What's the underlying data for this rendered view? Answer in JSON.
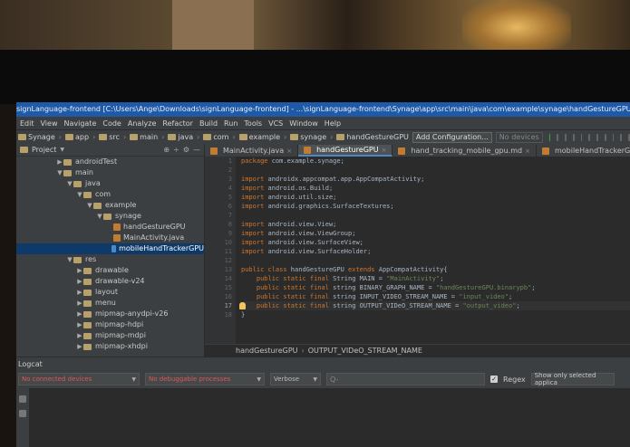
{
  "title": "signLanguage-frontend [C:\\Users\\Ange\\Downloads\\signLanguage-frontend] - ...\\signLanguage-frontend\\Synage\\app\\src\\main\\java\\com\\example\\synage\\handGestureGPU [signLan...",
  "menu": [
    "Edit",
    "View",
    "Navigate",
    "Code",
    "Analyze",
    "Refactor",
    "Build",
    "Run",
    "Tools",
    "VCS",
    "Window",
    "Help"
  ],
  "nav": {
    "crumbs": [
      "Synage",
      "app",
      "src",
      "main",
      "java",
      "com",
      "example",
      "synage",
      "handGestureGPU"
    ],
    "config_label": "Add Configuration...",
    "devices_label": "No devices"
  },
  "project_panel": {
    "label": "Project",
    "tree": [
      {
        "label": "androidTest",
        "depth": 0,
        "arrow": "▶",
        "kind": "folder"
      },
      {
        "label": "main",
        "depth": 0,
        "arrow": "▼",
        "kind": "folder"
      },
      {
        "label": "java",
        "depth": 1,
        "arrow": "▼",
        "kind": "folder"
      },
      {
        "label": "com",
        "depth": 2,
        "arrow": "▼",
        "kind": "folder"
      },
      {
        "label": "example",
        "depth": 3,
        "arrow": "▼",
        "kind": "folder"
      },
      {
        "label": "synage",
        "depth": 4,
        "arrow": "▼",
        "kind": "folder"
      },
      {
        "label": "handGestureGPU",
        "depth": 5,
        "arrow": "",
        "kind": "java"
      },
      {
        "label": "MainActivity.java",
        "depth": 5,
        "arrow": "",
        "kind": "java"
      },
      {
        "label": "mobileHandTrackerGPU",
        "depth": 5,
        "arrow": "",
        "kind": "java-blue",
        "selected": true
      },
      {
        "label": "res",
        "depth": 1,
        "arrow": "▼",
        "kind": "folder"
      },
      {
        "label": "drawable",
        "depth": 2,
        "arrow": "▶",
        "kind": "folder"
      },
      {
        "label": "drawable-v24",
        "depth": 2,
        "arrow": "▶",
        "kind": "folder"
      },
      {
        "label": "layout",
        "depth": 2,
        "arrow": "▶",
        "kind": "folder"
      },
      {
        "label": "menu",
        "depth": 2,
        "arrow": "▶",
        "kind": "folder"
      },
      {
        "label": "mipmap-anydpi-v26",
        "depth": 2,
        "arrow": "▶",
        "kind": "folder"
      },
      {
        "label": "mipmap-hdpi",
        "depth": 2,
        "arrow": "▶",
        "kind": "folder"
      },
      {
        "label": "mipmap-mdpi",
        "depth": 2,
        "arrow": "▶",
        "kind": "folder"
      },
      {
        "label": "mipmap-xhdpi",
        "depth": 2,
        "arrow": "▶",
        "kind": "folder"
      }
    ]
  },
  "tabs": [
    {
      "label": "MainActivity.java",
      "active": false
    },
    {
      "label": "handGestureGPU",
      "active": true
    },
    {
      "label": "hand_tracking_mobile_gpu.md",
      "active": false
    },
    {
      "label": "mobileHandTrackerGPU",
      "active": false
    }
  ],
  "editor": {
    "line_numbers": [
      "1",
      "2",
      "3",
      "4",
      "5",
      "6",
      "7",
      "8",
      "9",
      "10",
      "11",
      "12",
      "13",
      "14",
      "15",
      "16",
      "17",
      "18"
    ],
    "current_line": 17,
    "lines": [
      [
        {
          "t": "kw",
          "v": "package "
        },
        {
          "t": "p",
          "v": "com.example.synage;"
        }
      ],
      [],
      [
        {
          "t": "kw",
          "v": "import "
        },
        {
          "t": "p",
          "v": "androidx.appcompat.app.AppCompatActivity;"
        }
      ],
      [
        {
          "t": "kw",
          "v": "import "
        },
        {
          "t": "p",
          "v": "android.os.Build;"
        }
      ],
      [
        {
          "t": "kw",
          "v": "import "
        },
        {
          "t": "p",
          "v": "android.util.size;"
        }
      ],
      [
        {
          "t": "kw",
          "v": "import "
        },
        {
          "t": "p",
          "v": "android.graphics.SurfaceTextures;"
        }
      ],
      [],
      [
        {
          "t": "kw",
          "v": "import "
        },
        {
          "t": "p",
          "v": "android.view.View;"
        }
      ],
      [
        {
          "t": "kw",
          "v": "import "
        },
        {
          "t": "p",
          "v": "android.view.ViewGroup;"
        }
      ],
      [
        {
          "t": "kw",
          "v": "import "
        },
        {
          "t": "p",
          "v": "android.view.SurfaceView;"
        }
      ],
      [
        {
          "t": "kw",
          "v": "import "
        },
        {
          "t": "p",
          "v": "android.view.SurfaceHolder;"
        }
      ],
      [],
      [
        {
          "t": "kw",
          "v": "public class "
        },
        {
          "t": "p",
          "v": "handGestureGPU "
        },
        {
          "t": "kw",
          "v": "extends "
        },
        {
          "t": "p",
          "v": "AppCompatActivity{"
        }
      ],
      [
        {
          "t": "kw",
          "v": "    public static final "
        },
        {
          "t": "p",
          "v": "String MAIN = "
        },
        {
          "t": "str",
          "v": "\"MainActivity\""
        },
        {
          "t": "p",
          "v": ";"
        }
      ],
      [
        {
          "t": "kw",
          "v": "    public static final "
        },
        {
          "t": "p",
          "v": "string BINARY_GRAPH_NAME = "
        },
        {
          "t": "str",
          "v": "\"handGestureGPU.binarypb\""
        },
        {
          "t": "p",
          "v": ";"
        }
      ],
      [
        {
          "t": "kw",
          "v": "    public static final "
        },
        {
          "t": "p",
          "v": "string INPUT_VIDEO_STREAM_NAME = "
        },
        {
          "t": "str",
          "v": "\"input_video\""
        },
        {
          "t": "p",
          "v": ";"
        }
      ],
      [
        {
          "t": "kw",
          "v": "    public static final "
        },
        {
          "t": "p",
          "v": "string OUTPUT_VIDeO_STREAM_NAME = "
        },
        {
          "t": "str",
          "v": "\"output_video\""
        },
        {
          "t": "p",
          "v": ";"
        }
      ],
      [
        {
          "t": "p",
          "v": "}"
        }
      ]
    ]
  },
  "editor_breadcrumb": [
    "handGestureGPU",
    "OUTPUT_VIDeO_STREAM_NAME"
  ],
  "logcat": {
    "title": "Logcat",
    "device_select": "No connected devices",
    "process_select": "No debuggable processes",
    "level_select": "Verbose",
    "search_placeholder": "Q-",
    "regex_label": "Regex",
    "filter_select": "Show only selected applica"
  },
  "colors": {
    "titlebar": "#1e5aa8",
    "selection": "#0d3a6b",
    "keyword": "#cc7832",
    "string": "#6a8759",
    "error_text": "#e05555"
  }
}
